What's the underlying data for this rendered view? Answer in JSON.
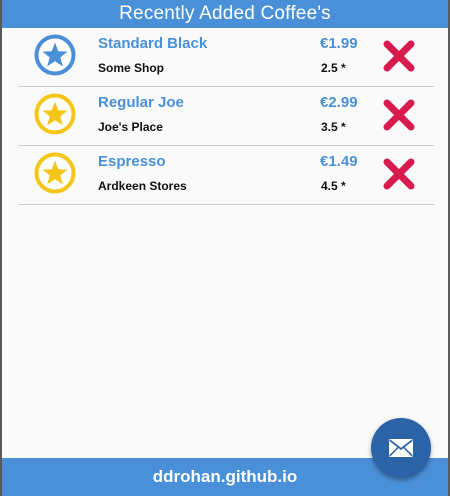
{
  "header": {
    "title": "Recently Added Coffee's"
  },
  "coffees": [
    {
      "name": "Standard Black",
      "shop": "Some Shop",
      "price": "€1.99",
      "rating": "2.5 *",
      "star_icon": "star-circle-icon",
      "star_color": "#4a90d9"
    },
    {
      "name": "Regular Joe",
      "shop": "Joe's Place",
      "price": "€2.99",
      "rating": "3.5 *",
      "star_icon": "star-circle-icon",
      "star_color": "#f5c518"
    },
    {
      "name": "Espresso",
      "shop": "Ardkeen Stores",
      "price": "€1.49",
      "rating": "4.5 *",
      "star_icon": "star-circle-icon",
      "star_color": "#f5c518"
    }
  ],
  "delete_icon": "close-x-icon",
  "footer": {
    "text": "ddrohan.github.io"
  },
  "fab": {
    "icon": "mail-icon"
  },
  "colors": {
    "accent": "#4a90d9",
    "delete": "#d81b4f",
    "fab": "#2b63a6"
  }
}
